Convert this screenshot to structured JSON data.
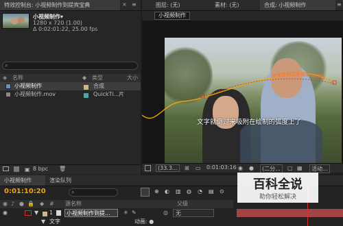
{
  "top_left_tabs": {
    "effect_controls": "特效控制台: 小视频制作到提宾宝典",
    "close": "×",
    "menu": "≡"
  },
  "project_preview": {
    "name": "小视频制作▾",
    "resolution": "1280 x 720 (1.00)",
    "duration": "Δ 0:02:01:22, 25.00 fps"
  },
  "project_search": {
    "placeholder": ""
  },
  "project_headers": {
    "name": "名称",
    "type": "类型",
    "size": "大小"
  },
  "project_items": [
    {
      "name": "小视频制作",
      "type": "合成",
      "size": ""
    },
    {
      "name": "小视频制作.mov",
      "type": "QuickTi...片",
      "size": ""
    }
  ],
  "project_footer": {
    "bpc": "8 bpc"
  },
  "right_tabs": {
    "layer": "图层: (无)",
    "footage": "素材: (无)",
    "composition": "合成: 小视频制作",
    "menu": "≡"
  },
  "comp_tab_label": "小视频制作",
  "subtitle": "文字就倒过来吸附在绘制的弧度上了",
  "arc_text": "文字就倒过来吸附在绘制",
  "viewer_footer": {
    "zoom": "(33.3...",
    "timecode": "0:01:03:16",
    "resolution": "(二分...",
    "camera": "活动..."
  },
  "timeline_tabs": {
    "comp": "小视频制作",
    "render_queue": "渲染队列"
  },
  "timeline": {
    "timecode": "0:01:10:20",
    "search_placeholder": "",
    "col_source": "源名称",
    "col_parent": "父级",
    "layer_num": "1",
    "layer_name": "小视频制作到提...",
    "layer_parent": "无",
    "sub_item": "文字",
    "anim_label": "动画: ●"
  },
  "watermark": {
    "title": "百科全说",
    "subtitle": "助你轻松解决"
  },
  "colors": {
    "accent": "#f0a30a",
    "blue": "#2b6cc4",
    "red": "#d63030",
    "tab_active": "#3a3a3a"
  }
}
